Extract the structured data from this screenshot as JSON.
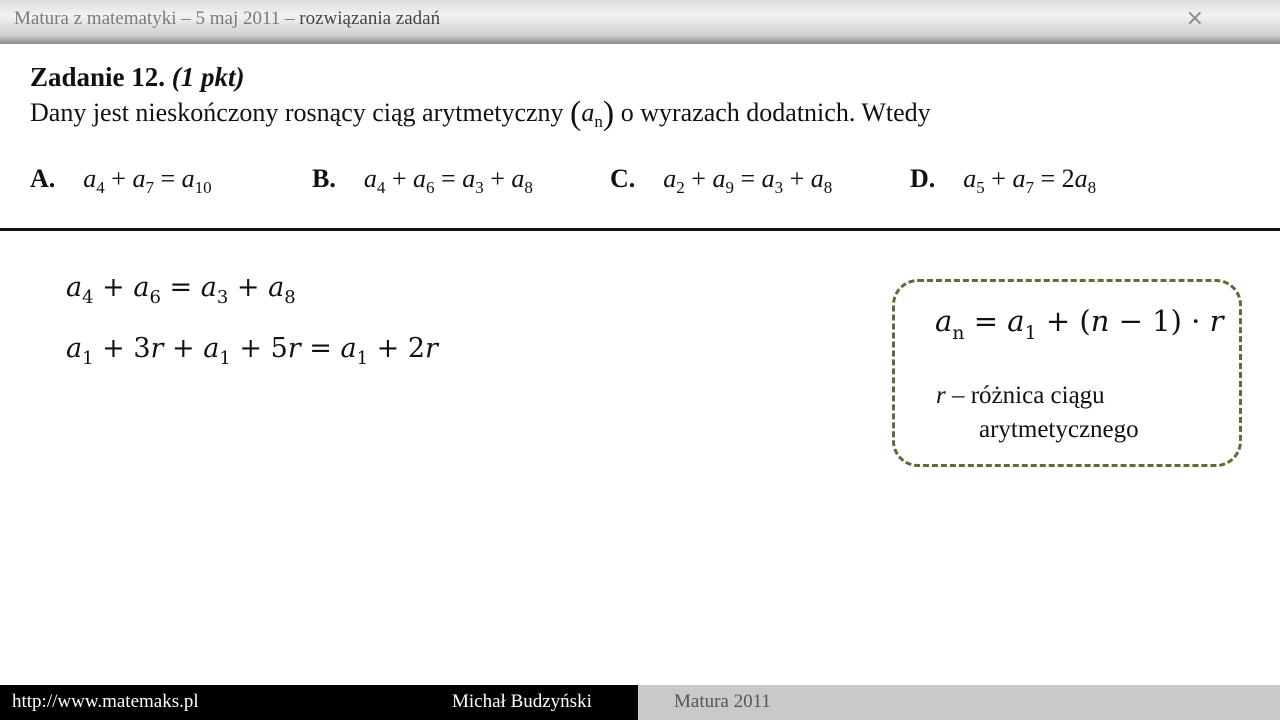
{
  "header": {
    "title_prefix": "Matura z matematyki – 5 maj 2011 – ",
    "title_highlight": "rozwiązania zadań",
    "close_symbol": "×",
    "close_icon": "close-icon"
  },
  "task": {
    "title_main": "Zadanie 12. ",
    "title_points": "(1 pkt)",
    "text_before": "Dany jest nieskończony rosnący ciąg arytmetyczny ",
    "seq_open": "(",
    "seq_var": "a",
    "seq_sub": "n",
    "seq_close": ")",
    "text_after": " o wyrazach dodatnich. Wtedy"
  },
  "options": [
    {
      "letter": "A.",
      "t1": "a",
      "s1": "4",
      "op1": " + ",
      "t2": "a",
      "s2": "7",
      "op2": " = ",
      "t3": "a",
      "s3": "10",
      "op3": "",
      "t4": "",
      "s4": ""
    },
    {
      "letter": "B.",
      "t1": "a",
      "s1": "4",
      "op1": " + ",
      "t2": "a",
      "s2": "6",
      "op2": " = ",
      "t3": "a",
      "s3": "3",
      "op3": " + ",
      "t4": "a",
      "s4": "8"
    },
    {
      "letter": "C.",
      "t1": "a",
      "s1": "2",
      "op1": " + ",
      "t2": "a",
      "s2": "9",
      "op2": " = ",
      "t3": "a",
      "s3": "3",
      "op3": " + ",
      "t4": "a",
      "s4": "8"
    },
    {
      "letter": "D.",
      "t1": "a",
      "s1": "5",
      "op1": " + ",
      "t2": "a",
      "s2": "7",
      "op2": " = 2",
      "t3": "a",
      "s3": "8",
      "op3": "",
      "t4": "",
      "s4": ""
    }
  ],
  "solution": {
    "line1": {
      "t1": "a",
      "s1": "4",
      "op1": " + ",
      "t2": "a",
      "s2": "6",
      "op2": " = ",
      "t3": "a",
      "s3": "3",
      "op3": " + ",
      "t4": "a",
      "s4": "8"
    },
    "line2": {
      "t1": "a",
      "s1": "1",
      "op1": " + 3",
      "r1": "r",
      "op2": " + ",
      "t2": "a",
      "s2": "1",
      "op3": " + 5",
      "r2": "r",
      "op4": " = ",
      "t3": "a",
      "s3": "1",
      "op5": " + 2",
      "r3": "r"
    }
  },
  "formula_box": {
    "lhs_var": "a",
    "lhs_sub": "n",
    "eq": " = ",
    "a1_var": "a",
    "a1_sub": "1",
    "mid": " + (",
    "n_var": "n",
    "tail": " − 1) · ",
    "r_var": "r",
    "note_var": "r",
    "note_rest": " – różnica ciągu",
    "note_line2": "arytmetycznego"
  },
  "footer": {
    "url": "http://www.matemaks.pl",
    "author": "Michał Budzyński",
    "exam": "Matura 2011"
  },
  "colors": {
    "box_border": "#5f6b3a",
    "footer_dark": "#000000",
    "footer_light": "#c9c9c9"
  }
}
